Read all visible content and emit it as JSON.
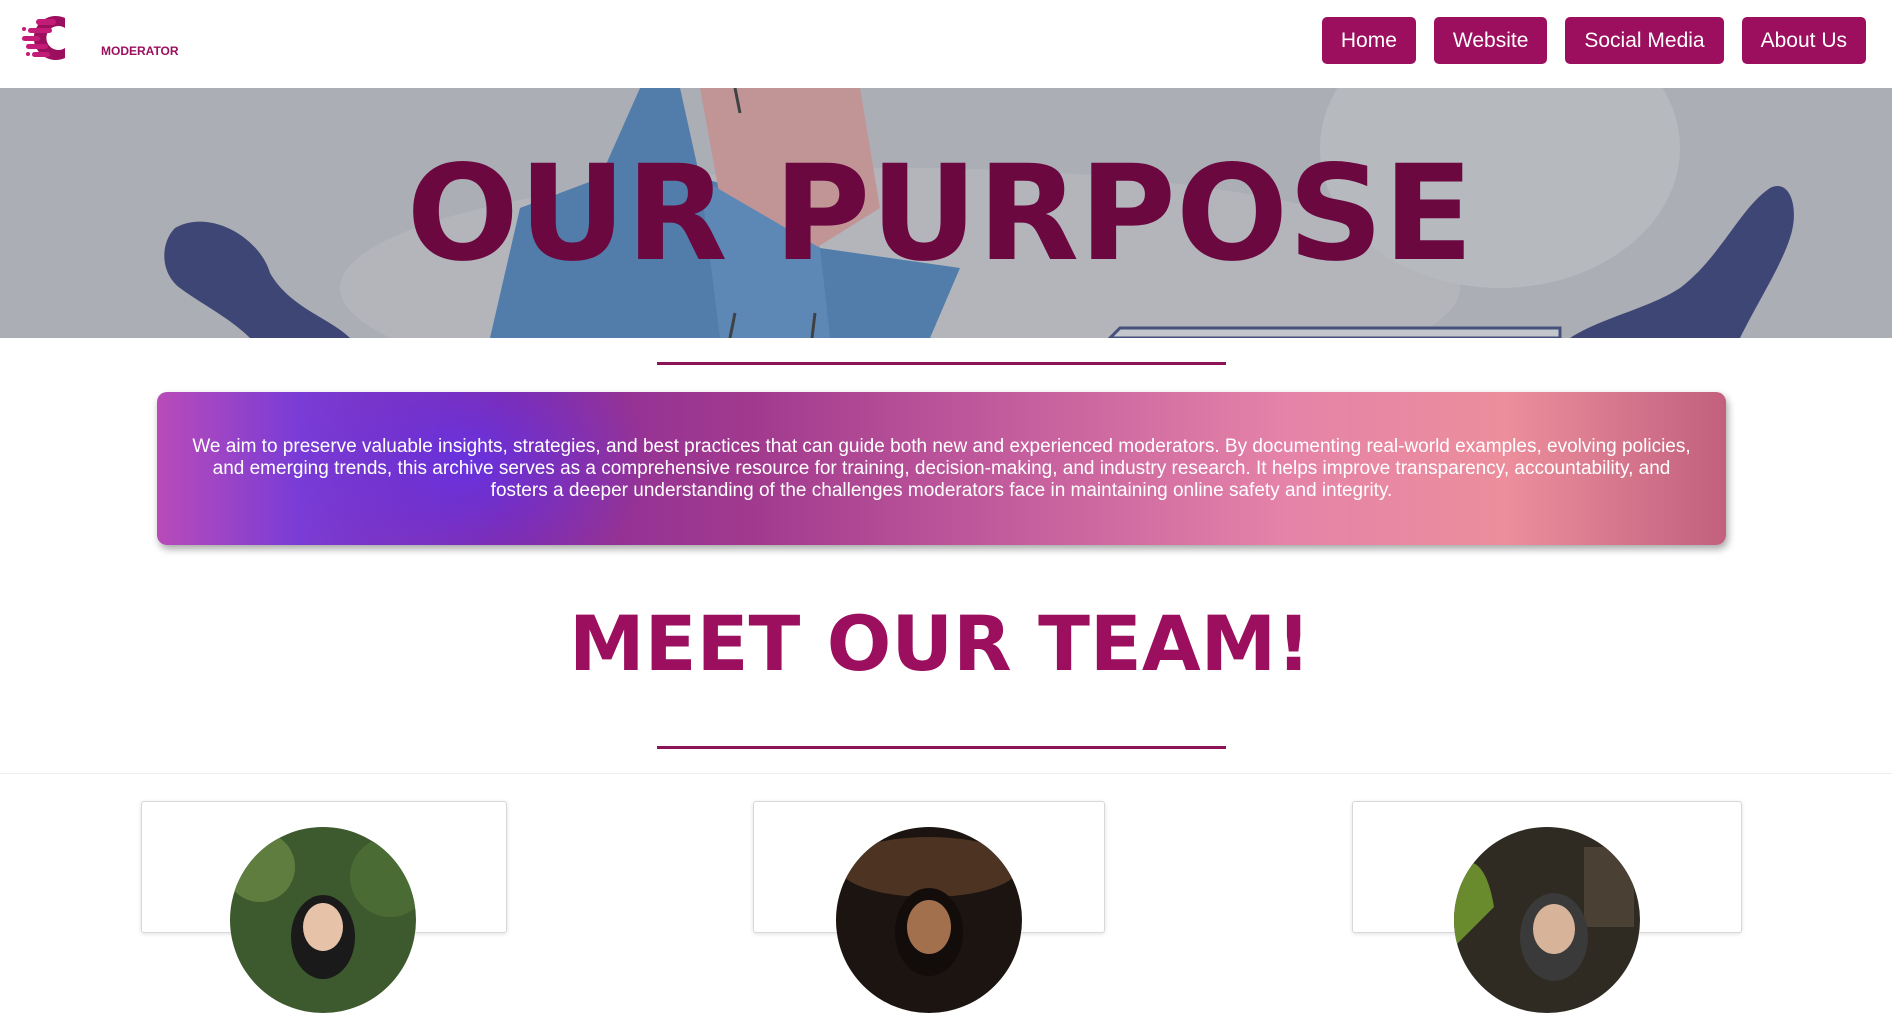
{
  "brand": {
    "logo_text": "MODERATOR",
    "color": "#9b0f5e"
  },
  "nav": {
    "items": [
      {
        "label": "Home"
      },
      {
        "label": "Website"
      },
      {
        "label": "Social Media"
      },
      {
        "label": "About Us"
      }
    ]
  },
  "hero": {
    "title": "OUR PURPOSE"
  },
  "purpose": {
    "text": "We aim to preserve valuable insights, strategies, and best practices that can guide both new and experienced moderators. By documenting real-world examples, evolving policies, and emerging trends, this archive serves as a comprehensive resource for training, decision-making, and industry research. It helps improve transparency, accountability, and fosters a deeper understanding of the challenges moderators face in maintaining online safety and integrity."
  },
  "team": {
    "title": "MEET OUR TEAM!"
  },
  "colors": {
    "accent": "#9b0f5e",
    "hero_title": "#6c0840",
    "divider": "#8d1357"
  }
}
